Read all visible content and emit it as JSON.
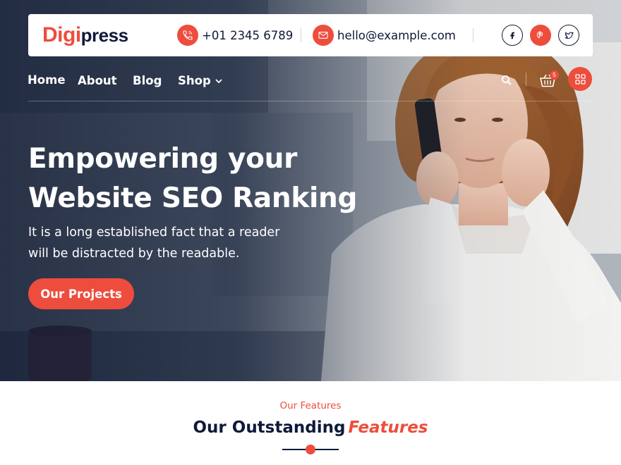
{
  "brand": {
    "logo_part1": "Digi",
    "logo_part2": "press",
    "accent_color": "#ee4d3d",
    "dark_color": "#0f1a3a"
  },
  "topbar": {
    "phone": {
      "icon": "phone-icon",
      "text": "+01 2345 6789"
    },
    "email": {
      "icon": "mail-icon",
      "text": "hello@example.com"
    },
    "social": [
      {
        "name": "facebook",
        "icon": "facebook-icon",
        "glyph": "f",
        "active": false
      },
      {
        "name": "pinterest",
        "icon": "pinterest-icon",
        "glyph": "P",
        "active": true
      },
      {
        "name": "twitter",
        "icon": "twitter-icon",
        "glyph": "t",
        "active": false
      }
    ]
  },
  "nav": {
    "items": [
      {
        "label": "Home"
      },
      {
        "label": "About"
      },
      {
        "label": "Blog"
      },
      {
        "label": "Shop",
        "has_dropdown": true
      }
    ],
    "search_icon": "search-icon",
    "cart_icon": "cart-icon",
    "cart_count": "5",
    "menu_icon": "grid-menu-icon"
  },
  "hero": {
    "title_line1": "Empowering your",
    "title_line2": "Website SEO Ranking",
    "subtitle_line1": "It is a long established fact that a reader",
    "subtitle_line2": "will be distracted by the readable.",
    "cta_label": "Our Projects"
  },
  "features": {
    "kicker": "Our Features",
    "title_main": "Our Outstanding",
    "title_accent": "Features"
  }
}
